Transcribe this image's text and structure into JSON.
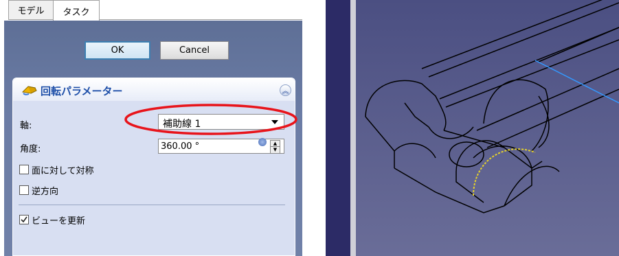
{
  "tabs": [
    {
      "label": "モデル"
    },
    {
      "label": "タスク"
    }
  ],
  "dialog": {
    "ok_label": "OK",
    "cancel_label": "Cancel"
  },
  "revolution": {
    "title": "回転パラメーター",
    "axis_label": "軸:",
    "axis_value": "補助線 1",
    "angle_label": "角度:",
    "angle_value": "360.00 °",
    "symmetric_label": "面に対して対称",
    "symmetric_checked": false,
    "reversed_label": "逆方向",
    "reversed_checked": false,
    "update_view_label": "ビューを更新",
    "update_view_checked": true
  },
  "colors": {
    "highlight_ellipse": "#e8141b",
    "viewport_background": "#5d6190",
    "axis_line": "#3399ff",
    "selected_edge": "#e6d22a"
  }
}
